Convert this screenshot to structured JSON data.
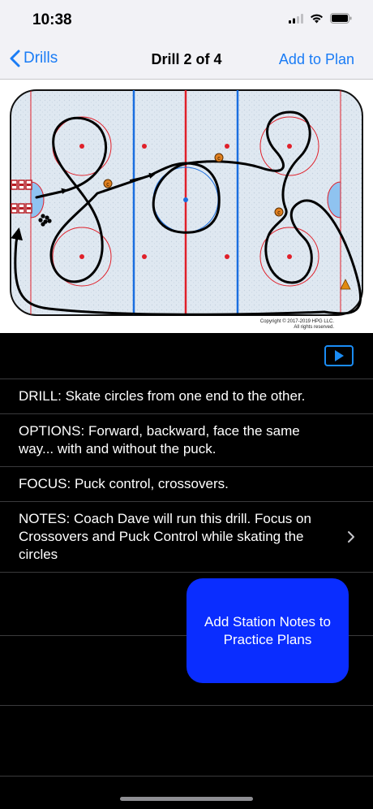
{
  "status_bar": {
    "time": "10:38"
  },
  "nav": {
    "back_label": "Drills",
    "title": "Drill 2 of 4",
    "right_label": "Add to Plan"
  },
  "diagram": {
    "copyright_line1": "Copyright © 2017-2019 HPG LLC.",
    "copyright_line2": "All rights reserved.",
    "puck_label": "c"
  },
  "info": {
    "drill": "DRILL: Skate circles from one end to the other.",
    "options": "OPTIONS: Forward, backward, face the same way... with and without the puck.",
    "focus": "FOCUS: Puck control, crossovers.",
    "notes": "NOTES: Coach Dave will run this drill.  Focus on Crossovers and Puck Control while skating the circles"
  },
  "station_button": {
    "label": "Add Station Notes to Practice Plans"
  },
  "colors": {
    "accent": "#1a7cf5",
    "station_button": "#0a2dff",
    "red_line": "#e0202a",
    "blue_line": "#1a6ee0"
  }
}
